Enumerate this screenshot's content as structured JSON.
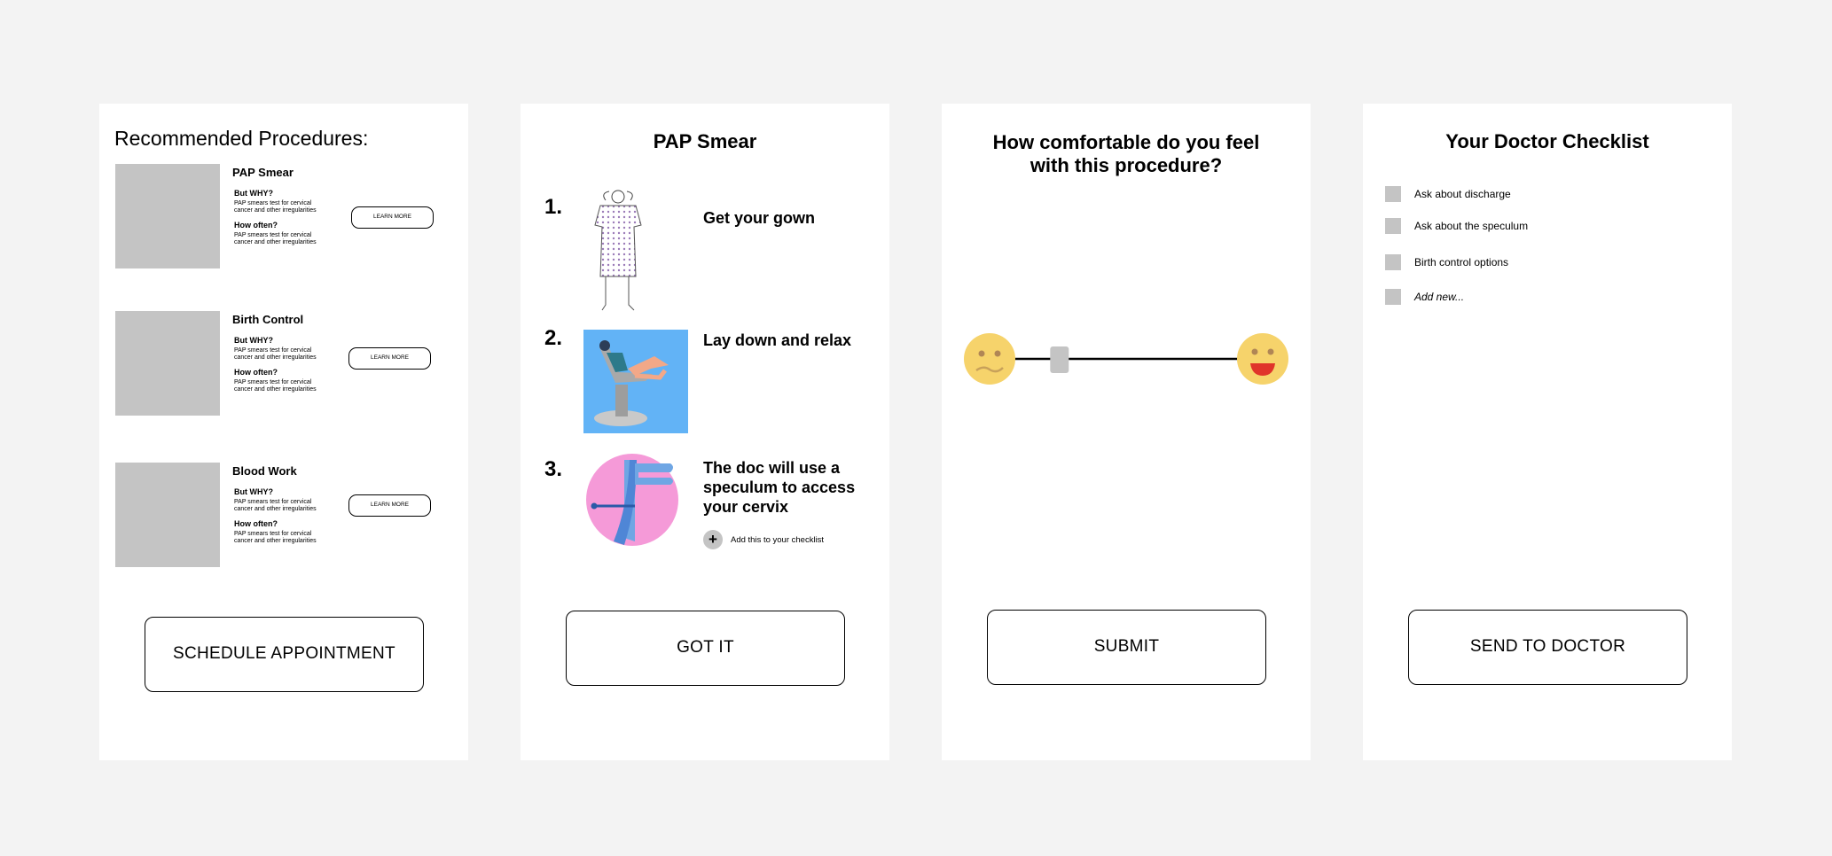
{
  "procedures_screen": {
    "title": "Recommended Procedures:",
    "items": [
      {
        "name": "PAP Smear",
        "why_label": "But WHY?",
        "why_text": "PAP smears test for cervical cancer and other irregularities",
        "often_label": "How often?",
        "often_text": "PAP smears test for cervical cancer and other irregularities",
        "learn_label": "LEARN MORE"
      },
      {
        "name": "Birth Control",
        "why_label": "But WHY?",
        "why_text": "PAP smears test for cervical cancer and other irregularities",
        "often_label": "How often?",
        "often_text": "PAP smears test for cervical cancer and other irregularities",
        "learn_label": "LEARN MORE"
      },
      {
        "name": "Blood Work",
        "why_label": "But WHY?",
        "why_text": "PAP smears test for cervical cancer and other irregularities",
        "often_label": "How often?",
        "often_text": "PAP smears test for cervical cancer and other irregularities",
        "learn_label": "LEARN MORE"
      }
    ],
    "button_label": "SCHEDULE APPOINTMENT"
  },
  "pap_screen": {
    "title": "PAP Smear",
    "steps": [
      {
        "number": "1.",
        "text": "Get your gown",
        "icon": "gown-illustration"
      },
      {
        "number": "2.",
        "text": "Lay down and relax",
        "icon": "exam-chair-illustration"
      },
      {
        "number": "3.",
        "text": "The doc will use a speculum to access your cervix",
        "icon": "speculum-illustration"
      }
    ],
    "add_label": "Add this to your checklist",
    "button_label": "GOT IT"
  },
  "comfort_screen": {
    "title_line1": "How comfortable do you feel",
    "title_line2": "with this procedure?",
    "slider_level": 0.2,
    "button_label": "SUBMIT",
    "colors": {
      "emoji": "#f6d36b",
      "mouth": "#e0342a"
    }
  },
  "checklist_screen": {
    "title": "Your Doctor Checklist",
    "items": [
      {
        "label": "Ask about discharge"
      },
      {
        "label": "Ask about the speculum"
      },
      {
        "label": "Birth control options"
      },
      {
        "label": "Add new..."
      }
    ],
    "button_label": "SEND TO DOCTOR"
  }
}
